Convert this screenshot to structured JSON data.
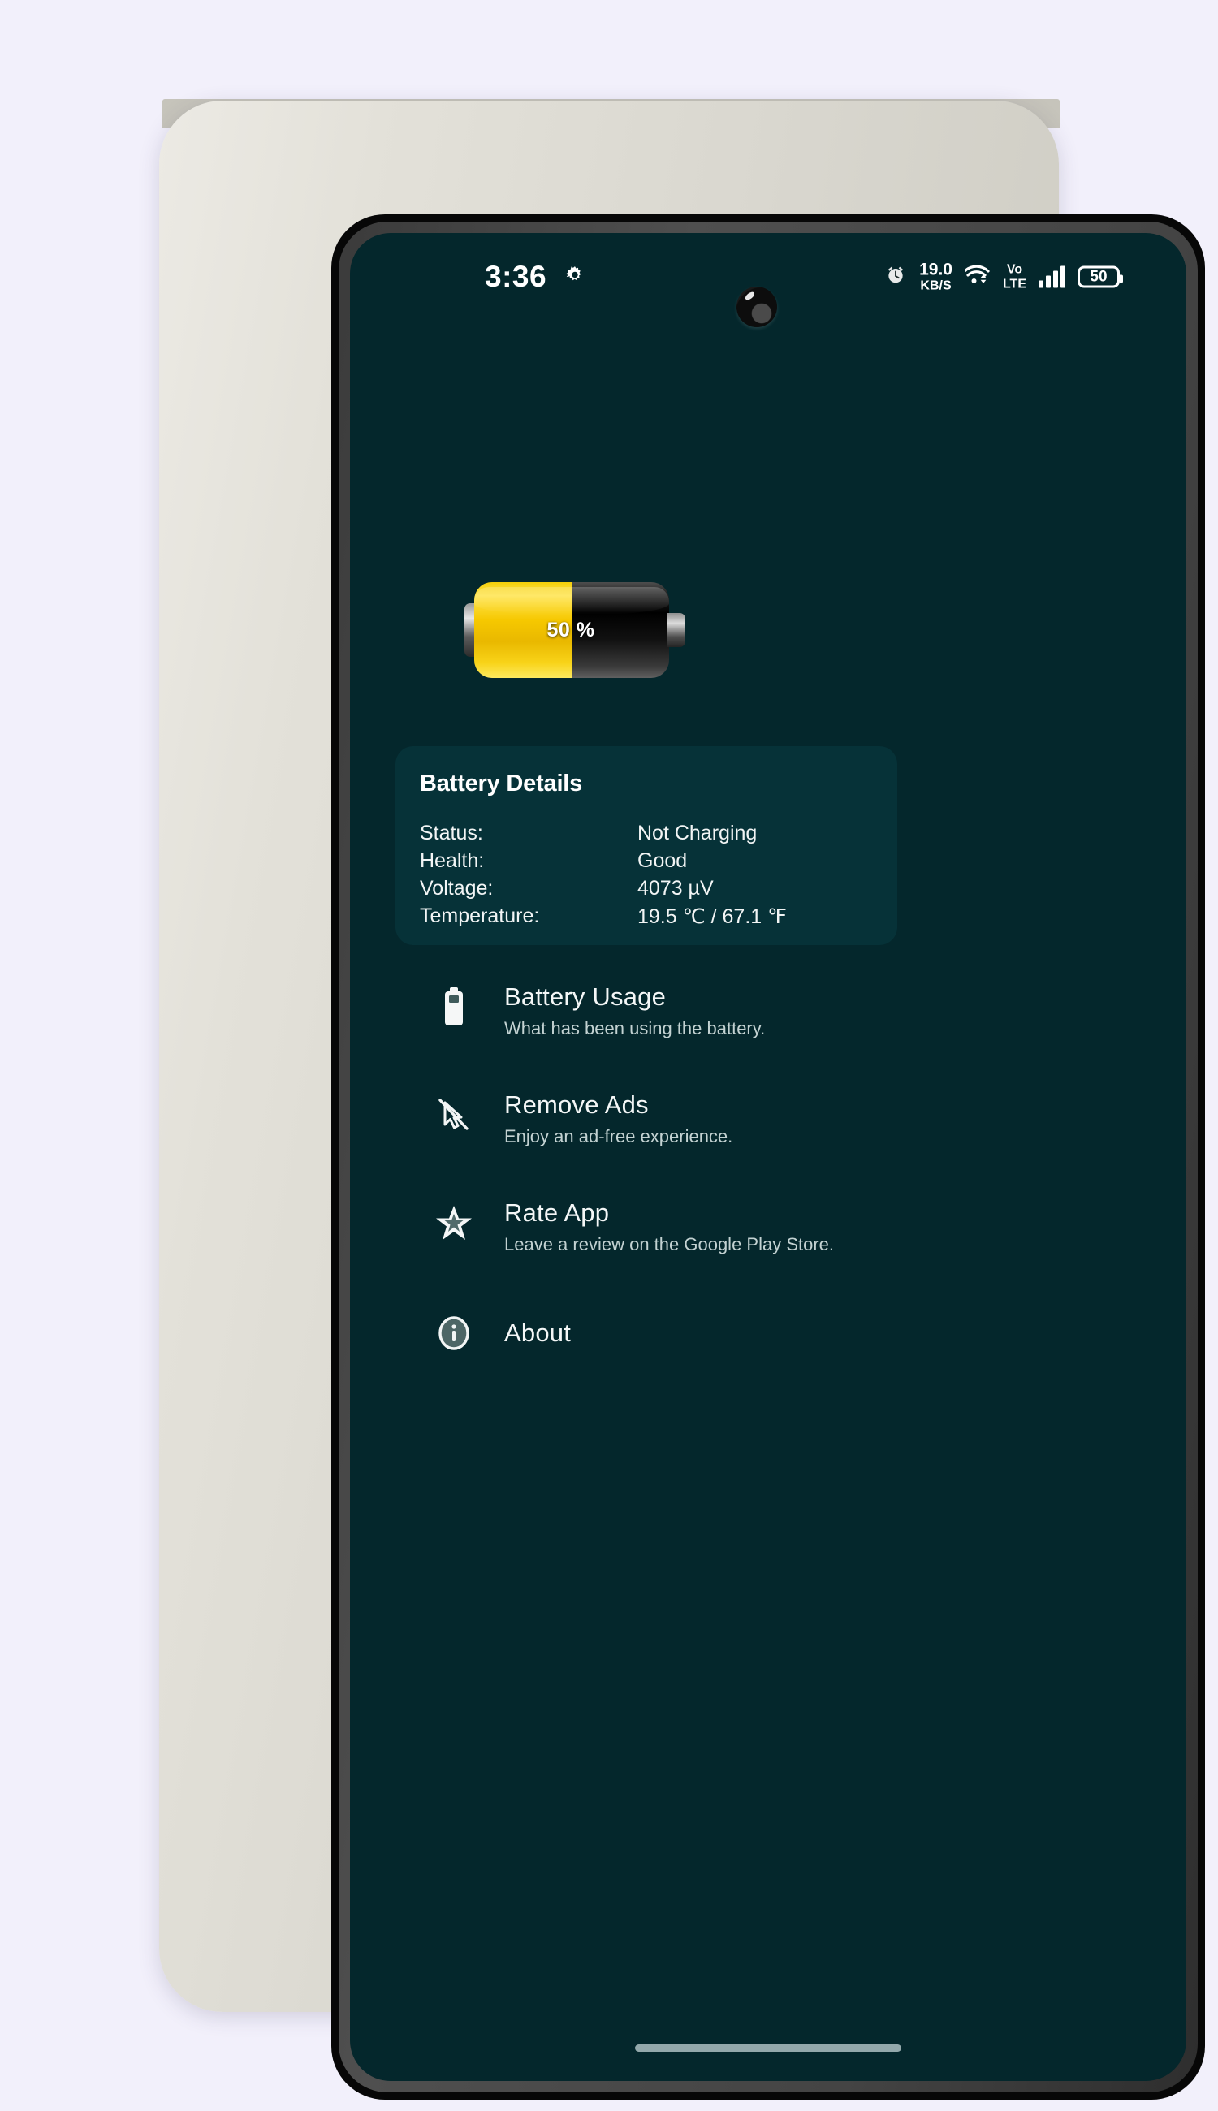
{
  "status_bar": {
    "clock": "3:36",
    "gear_icon": "gear-icon",
    "alarm_icon": "alarm-clock-icon",
    "net_speed_value": "19.0",
    "net_speed_unit": "KB/S",
    "wifi_icon": "wifi-icon",
    "volte_top": "Vo",
    "volte_bottom": "LTE",
    "signal_icon": "signal-bars-icon",
    "battery_level": "50"
  },
  "battery_hero": {
    "percent_label": "50 %",
    "fill_percent": 50,
    "fill_color": "#f6c800",
    "empty_color": "#111111"
  },
  "details_card": {
    "title": "Battery Details",
    "rows": [
      {
        "label": "Status:",
        "value": "Not Charging"
      },
      {
        "label": "Health:",
        "value": "Good"
      },
      {
        "label": "Voltage:",
        "value": "4073 µV"
      },
      {
        "label": "Temperature:",
        "value": "19.5 ℃ / 67.1 ℉"
      }
    ]
  },
  "menu": {
    "items": [
      {
        "icon": "battery-icon",
        "title": "Battery Usage",
        "subtitle": "What has been using the battery."
      },
      {
        "icon": "ads-off-cursor-icon",
        "title": "Remove Ads",
        "subtitle": "Enjoy an ad-free experience."
      },
      {
        "icon": "star-icon",
        "title": "Rate App",
        "subtitle": "Leave a review on the Google Play Store."
      },
      {
        "icon": "info-circle-icon",
        "title": "About",
        "subtitle": ""
      }
    ]
  },
  "theme": {
    "screen_background": "#04272c",
    "card_background": "#063238",
    "accent_yellow": "#f6c800",
    "text_primary": "#f4f7f7",
    "text_secondary": "#c3d2d2",
    "page_background": "#f2f0fb"
  }
}
